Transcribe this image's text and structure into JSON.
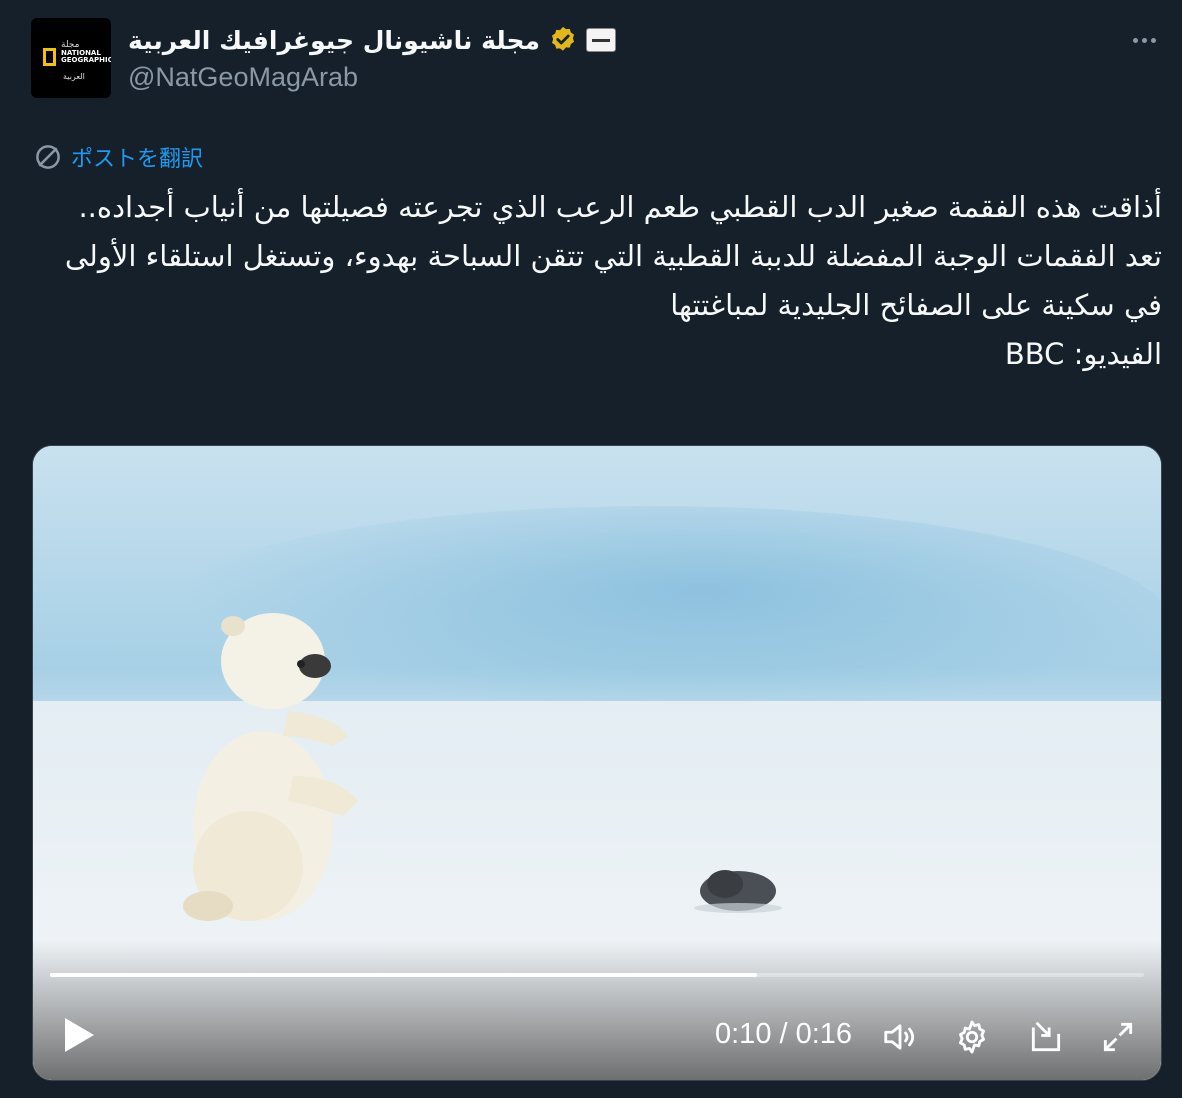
{
  "account": {
    "display_name": "مجلة ناشيونال جيوغرافيك العربية",
    "handle": "@NatGeoMagArab",
    "avatar": {
      "line1": "مجلة",
      "line2": "NATIONAL",
      "line3": "GEOGRAPHIC",
      "line4": "العربية"
    },
    "verified_icon": "verified-badge-gold-icon",
    "affiliate_icon": "affiliate-badge-icon"
  },
  "more_icon": "more-options-icon",
  "translate": {
    "label": "ポストを翻訳",
    "icon": "translate-globe-icon"
  },
  "tweet": {
    "line1": "أذاقت هذه الفقمة صغير الدب القطبي طعم الرعب الذي تجرعته فصيلتها من أنياب أجداده..",
    "line2": "تعد الفقمات الوجبة المفضلة للدببة القطبية التي تتقن السباحة بهدوء، وتستغل استلقاء الأولى في سكينة على الصفائح الجليدية لمباغتتها",
    "line3": "الفيديو: BBC"
  },
  "video": {
    "time_display": "0:10 / 0:16",
    "progress": 0.646,
    "icons": [
      "play-icon",
      "volume-icon",
      "settings-gear-icon",
      "pop-out-icon",
      "fullscreen-icon"
    ]
  },
  "colors": {
    "background": "#15202b",
    "text": "#f7f9f9",
    "secondary": "#8b98a5",
    "link": "#1d9bf0",
    "verified": "#e2b719"
  }
}
